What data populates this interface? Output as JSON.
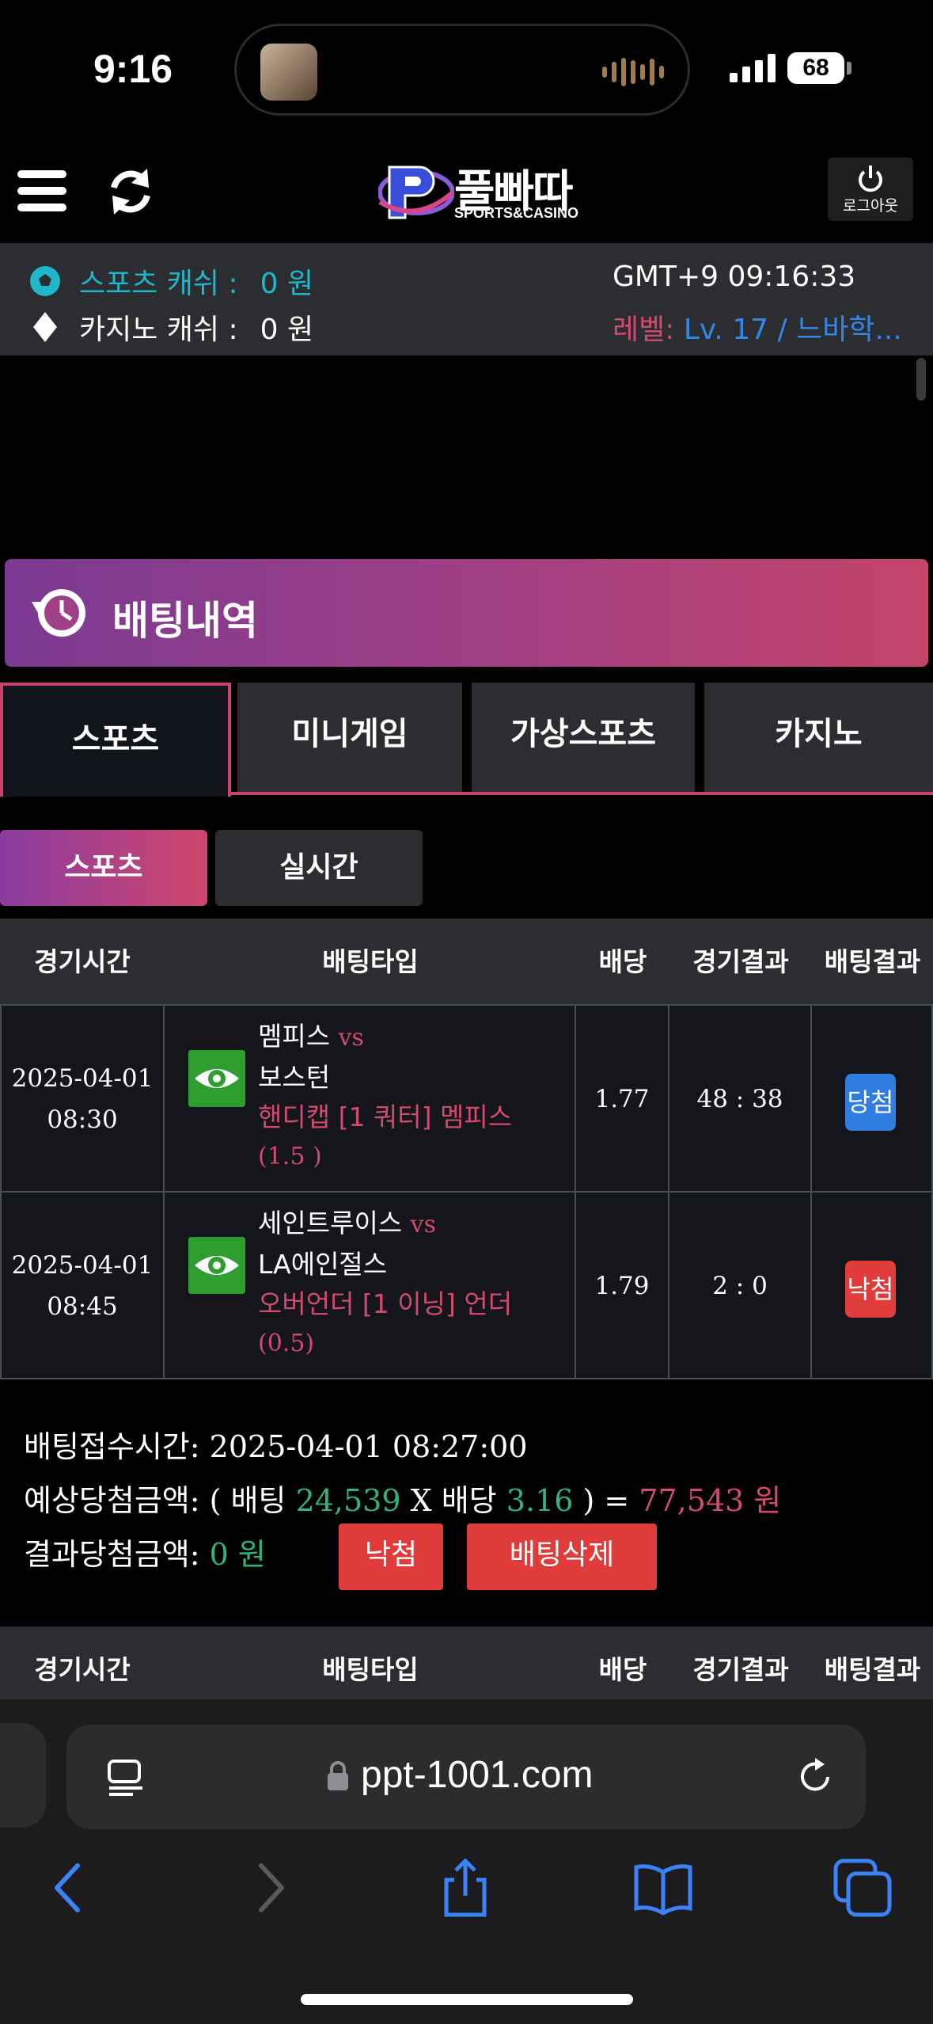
{
  "status": {
    "time": "9:16",
    "battery": "68"
  },
  "header": {
    "logo_text": "풀빠따",
    "logo_sub": "SPORTS&CASINO",
    "logout_label": "로그아웃"
  },
  "info": {
    "sports_cash_label": "스포츠 캐쉬 :",
    "sports_cash_value": "0 원",
    "casino_cash_label": "카지노 캐쉬 :",
    "casino_cash_value": "0 원",
    "clock": "GMT+9 09:16:33",
    "level_key": "레벨: ",
    "level_value": "Lv. 17 / 느바학...",
    "colors": {
      "sports": "#1fb7c9",
      "level_key": "#d44a6e",
      "level_value": "#2f88ea"
    }
  },
  "section": {
    "title": "배팅내역"
  },
  "category_tabs": [
    {
      "label": "스포츠",
      "active": true
    },
    {
      "label": "미니게임",
      "active": false
    },
    {
      "label": "가상스포츠",
      "active": false
    },
    {
      "label": "카지노",
      "active": false
    }
  ],
  "sub_tabs": [
    {
      "label": "스포츠",
      "active": true
    },
    {
      "label": "실시간",
      "active": false
    }
  ],
  "table": {
    "headers": [
      "경기시간",
      "배팅타입",
      "배당",
      "경기결과",
      "배팅결과"
    ],
    "rows": [
      {
        "date": "2025-04-01",
        "time": "08:30",
        "home": "멤피스",
        "vs": "vs",
        "away": "보스턴",
        "pick_line1": "핸디캡 [1 쿼터] 멤피스",
        "pick_line2": "(1.5 )",
        "odds": "1.77",
        "score": "48 : 38",
        "result": "당첨"
      },
      {
        "date": "2025-04-01",
        "time": "08:45",
        "home": "세인트루이스",
        "vs": "vs",
        "away": "LA에인절스",
        "pick_line1": "오버언더 [1 이닝] 언더",
        "pick_line2": "(0.5)",
        "odds": "1.79",
        "score": "2 : 0",
        "result": "낙첨"
      }
    ]
  },
  "summary": {
    "received_label": "배팅접수시간:",
    "received_value": "2025-04-01 08:27:00",
    "expected_label": "예상당첨금액: ( 배팅",
    "stake": "24,539",
    "x_label": "X 배당",
    "total_odds": "3.16",
    "close_eq": ") =",
    "expected_win": "77,543 원",
    "result_label": "결과당첨금액:",
    "result_value": "0 원",
    "status_button": "낙첨",
    "delete_button": "배팅삭제"
  },
  "browser": {
    "url": "ppt-1001.com"
  }
}
